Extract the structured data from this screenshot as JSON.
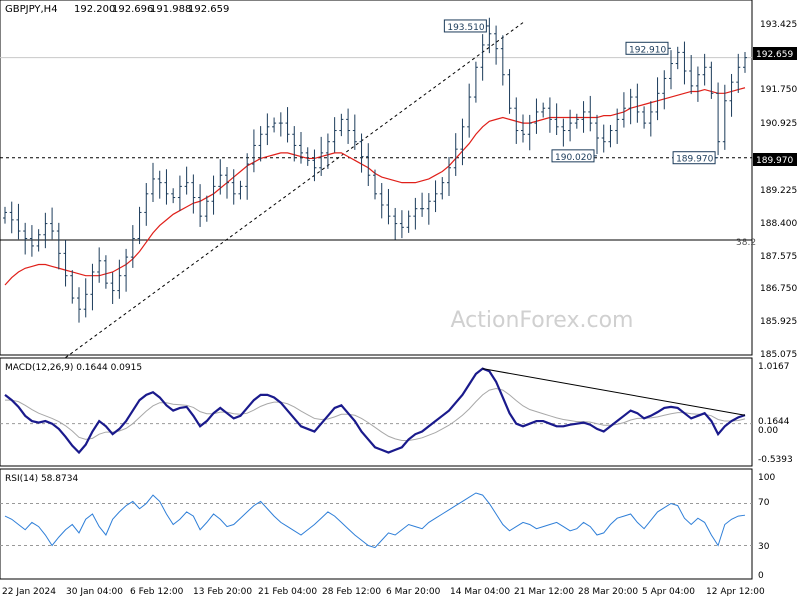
{
  "chart_data": {
    "type": "candlestick",
    "symbol": "GBPJPY,H4",
    "header_values": [
      "192.200",
      "192.696",
      "191.988",
      "192.659"
    ],
    "watermark": "ActionForex.com",
    "x_tick_labels": [
      "22 Jan 2024",
      "30 Jan 04:00",
      "6 Feb 12:00",
      "13 Feb 20:00",
      "21 Feb 04:00",
      "28 Feb 12:00",
      "6 Mar 20:00",
      "14 Mar 04:00",
      "21 Mar 12:00",
      "28 Mar 20:00",
      "5 Apr 04:00",
      "12 Apr 12:00"
    ],
    "price": {
      "ylim": [
        184.75,
        194.1
      ],
      "y_tick_labels": [
        "193.425",
        "192.659",
        "191.750",
        "190.925",
        "189.970",
        "189.225",
        "188.400",
        "187.575",
        "186.750",
        "185.925",
        "185.075"
      ],
      "current_price": "192.659",
      "series_names": [
        "Close",
        "MA"
      ],
      "closes": [
        188.5,
        188.3,
        188.0,
        187.8,
        187.6,
        187.9,
        188.2,
        188.0,
        187.4,
        186.8,
        186.2,
        185.9,
        186.3,
        186.9,
        187.2,
        186.6,
        186.4,
        186.8,
        187.3,
        187.8,
        188.5,
        189.0,
        189.4,
        189.3,
        189.0,
        188.9,
        189.2,
        189.3,
        188.9,
        188.4,
        188.8,
        189.2,
        189.5,
        189.3,
        189.0,
        189.2,
        189.8,
        190.3,
        190.6,
        190.8,
        190.9,
        190.9,
        190.6,
        190.3,
        190.1,
        189.9,
        189.7,
        190.1,
        190.4,
        190.7,
        191.0,
        190.7,
        190.4,
        190.0,
        189.5,
        189.0,
        188.7,
        188.4,
        188.2,
        188.1,
        188.4,
        188.6,
        188.6,
        188.8,
        189.0,
        189.3,
        189.7,
        190.2,
        190.8,
        191.6,
        192.4,
        193.0,
        193.3,
        192.9,
        192.2,
        191.3,
        190.7,
        190.6,
        190.9,
        191.2,
        191.3,
        191.0,
        190.8,
        190.7,
        190.9,
        191.0,
        191.2,
        190.9,
        190.5,
        190.4,
        190.7,
        191.0,
        191.3,
        191.6,
        191.2,
        190.9,
        191.2,
        191.7,
        192.1,
        192.5,
        192.8,
        192.3,
        191.9,
        192.2,
        192.4,
        191.7,
        190.4,
        191.5,
        192.0,
        192.4,
        192.659
      ],
      "ma_values": [
        186.55,
        186.75,
        186.9,
        187.0,
        187.05,
        187.1,
        187.1,
        187.05,
        187.0,
        186.95,
        186.9,
        186.85,
        186.8,
        186.8,
        186.8,
        186.85,
        186.9,
        187.0,
        187.1,
        187.25,
        187.45,
        187.7,
        187.95,
        188.15,
        188.3,
        188.45,
        188.55,
        188.65,
        188.75,
        188.8,
        188.9,
        189.0,
        189.15,
        189.3,
        189.45,
        189.6,
        189.75,
        189.85,
        189.95,
        190.0,
        190.05,
        190.1,
        190.1,
        190.05,
        190.0,
        189.95,
        189.95,
        190.0,
        190.05,
        190.1,
        190.1,
        190.0,
        189.9,
        189.8,
        189.7,
        189.55,
        189.45,
        189.4,
        189.35,
        189.3,
        189.3,
        189.3,
        189.35,
        189.4,
        189.5,
        189.6,
        189.75,
        189.95,
        190.15,
        190.35,
        190.6,
        190.8,
        190.95,
        191.0,
        191.05,
        191.0,
        190.95,
        190.9,
        190.9,
        190.95,
        191.0,
        191.05,
        191.05,
        191.05,
        191.05,
        191.05,
        191.05,
        191.05,
        191.05,
        191.1,
        191.1,
        191.15,
        191.2,
        191.3,
        191.35,
        191.4,
        191.45,
        191.5,
        191.55,
        191.6,
        191.65,
        191.7,
        191.75,
        191.75,
        191.8,
        191.75,
        191.7,
        191.7,
        191.75,
        191.8,
        191.85
      ],
      "levels": [
        {
          "value": 192.659,
          "style": "solid",
          "color": "#c8c8c8"
        },
        {
          "value": 189.97,
          "style": "dashed",
          "color": "#000000"
        },
        {
          "value": 187.76,
          "style": "solid",
          "color": "#000000"
        }
      ],
      "fib_label": "38.2",
      "fib_value": 187.76,
      "trendline": {
        "x": [
          9,
          77
        ],
        "y": [
          184.6,
          193.6
        ]
      },
      "annotations": [
        {
          "text": "193.510",
          "bar": 72,
          "value": 193.51,
          "side": "left"
        },
        {
          "text": "192.910",
          "bar": 99,
          "value": 192.91,
          "side": "left"
        },
        {
          "text": "190.020",
          "bar": 88,
          "value": 190.02,
          "side": "left"
        },
        {
          "text": "189.970",
          "bar": 106,
          "value": 189.97,
          "side": "left"
        }
      ]
    },
    "macd": {
      "label": "MACD(12,26,9) 0.1644 0.0915",
      "ylim": [
        -0.75,
        1.1
      ],
      "y_tick_labels": [
        "1.0167",
        "0.1644",
        "0.00",
        "-0.5393"
      ],
      "zero_line": 0.0,
      "macd_values": [
        0.55,
        0.45,
        0.32,
        0.15,
        0.05,
        0.02,
        0.05,
        0.0,
        -0.1,
        -0.25,
        -0.42,
        -0.55,
        -0.4,
        -0.15,
        0.05,
        -0.05,
        -0.2,
        -0.1,
        0.05,
        0.25,
        0.45,
        0.55,
        0.6,
        0.5,
        0.35,
        0.25,
        0.3,
        0.32,
        0.15,
        -0.05,
        0.05,
        0.2,
        0.3,
        0.2,
        0.1,
        0.15,
        0.3,
        0.45,
        0.55,
        0.55,
        0.5,
        0.4,
        0.25,
        0.1,
        -0.05,
        -0.1,
        -0.15,
        0.0,
        0.15,
        0.3,
        0.35,
        0.2,
        0.05,
        -0.15,
        -0.3,
        -0.45,
        -0.5,
        -0.55,
        -0.5,
        -0.45,
        -0.3,
        -0.2,
        -0.15,
        -0.05,
        0.05,
        0.15,
        0.25,
        0.4,
        0.55,
        0.75,
        0.95,
        1.05,
        1.0,
        0.8,
        0.5,
        0.2,
        0.0,
        -0.05,
        0.0,
        0.05,
        0.05,
        0.0,
        -0.05,
        -0.05,
        -0.02,
        0.0,
        0.02,
        -0.02,
        -0.1,
        -0.15,
        -0.05,
        0.05,
        0.15,
        0.25,
        0.2,
        0.1,
        0.15,
        0.22,
        0.3,
        0.32,
        0.3,
        0.2,
        0.1,
        0.15,
        0.2,
        0.05,
        -0.2,
        -0.05,
        0.05,
        0.12,
        0.1644
      ],
      "signal_values": [
        0.45,
        0.45,
        0.42,
        0.35,
        0.27,
        0.2,
        0.15,
        0.1,
        0.04,
        -0.04,
        -0.14,
        -0.26,
        -0.3,
        -0.28,
        -0.2,
        -0.16,
        -0.16,
        -0.14,
        -0.09,
        0.0,
        0.12,
        0.24,
        0.34,
        0.4,
        0.4,
        0.37,
        0.36,
        0.35,
        0.31,
        0.23,
        0.19,
        0.19,
        0.22,
        0.22,
        0.19,
        0.18,
        0.2,
        0.26,
        0.33,
        0.38,
        0.41,
        0.41,
        0.38,
        0.32,
        0.24,
        0.17,
        0.1,
        0.08,
        0.09,
        0.13,
        0.18,
        0.18,
        0.16,
        0.1,
        0.02,
        -0.07,
        -0.16,
        -0.24,
        -0.29,
        -0.32,
        -0.32,
        -0.3,
        -0.27,
        -0.22,
        -0.17,
        -0.1,
        -0.03,
        0.06,
        0.16,
        0.28,
        0.42,
        0.55,
        0.64,
        0.67,
        0.64,
        0.55,
        0.44,
        0.34,
        0.27,
        0.23,
        0.19,
        0.15,
        0.11,
        0.08,
        0.06,
        0.04,
        0.04,
        0.03,
        0.0,
        -0.03,
        -0.03,
        -0.01,
        0.02,
        0.07,
        0.1,
        0.1,
        0.11,
        0.13,
        0.16,
        0.19,
        0.21,
        0.21,
        0.19,
        0.18,
        0.18,
        0.15,
        0.08,
        0.05,
        0.05,
        0.06,
        0.0915
      ]
    },
    "rsi": {
      "label": "RSI(14) 58.8734",
      "ylim": [
        0,
        100
      ],
      "y_tick_labels": [
        "100",
        "70",
        "30",
        "0"
      ],
      "levels": [
        70,
        30
      ],
      "values": [
        58,
        55,
        50,
        45,
        52,
        48,
        40,
        30,
        38,
        45,
        50,
        42,
        55,
        60,
        48,
        40,
        55,
        62,
        68,
        72,
        65,
        70,
        78,
        72,
        60,
        50,
        55,
        62,
        58,
        45,
        52,
        60,
        55,
        48,
        50,
        56,
        62,
        68,
        72,
        65,
        58,
        52,
        48,
        44,
        40,
        45,
        50,
        56,
        62,
        58,
        52,
        46,
        40,
        35,
        30,
        28,
        35,
        42,
        40,
        45,
        50,
        48,
        46,
        52,
        56,
        60,
        64,
        68,
        72,
        76,
        80,
        78,
        70,
        60,
        50,
        44,
        48,
        52,
        50,
        46,
        48,
        50,
        52,
        48,
        44,
        46,
        52,
        48,
        40,
        42,
        50,
        56,
        58,
        60,
        52,
        46,
        54,
        62,
        66,
        70,
        68,
        56,
        50,
        56,
        52,
        40,
        30,
        50,
        55,
        58,
        58.87
      ]
    }
  }
}
